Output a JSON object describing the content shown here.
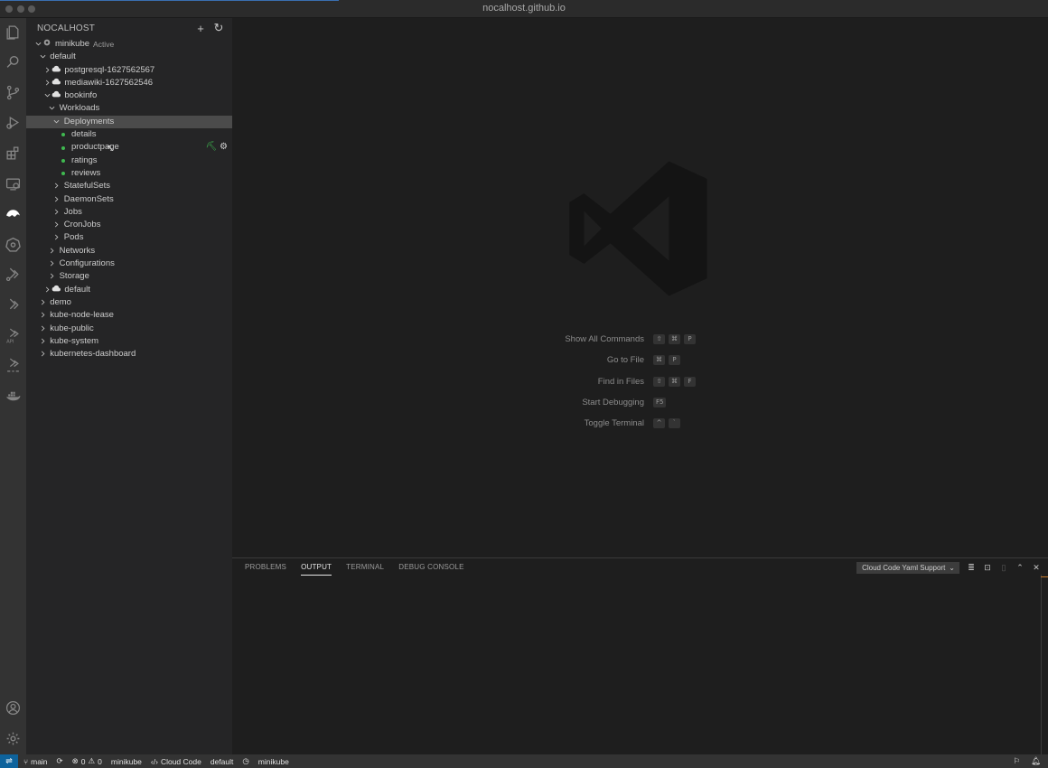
{
  "window": {
    "title": "nocalhost.github.io"
  },
  "sidebar": {
    "header": "NOCALHOST",
    "tree": [
      {
        "label": "minikube",
        "tag": "Active",
        "indent": 1,
        "chevron": "down",
        "icon": "cluster-icon"
      },
      {
        "label": "default",
        "indent": 2,
        "chevron": "down"
      },
      {
        "label": "postgresql-1627562567",
        "indent": 3,
        "chevron": "right",
        "icon": "cloud-icon"
      },
      {
        "label": "mediawiki-1627562546",
        "indent": 3,
        "chevron": "right",
        "icon": "cloud-icon"
      },
      {
        "label": "bookinfo",
        "indent": 3,
        "chevron": "down",
        "icon": "cloud-icon"
      },
      {
        "label": "Workloads",
        "indent": 4,
        "chevron": "down"
      },
      {
        "label": "Deployments",
        "indent": 5,
        "chevron": "down",
        "selected": true
      },
      {
        "label": "details",
        "indent": 6,
        "dot": true
      },
      {
        "label": "productpage",
        "indent": 6,
        "dot": true,
        "actions": true
      },
      {
        "label": "ratings",
        "indent": 6,
        "dot": true
      },
      {
        "label": "reviews",
        "indent": 6,
        "dot": true
      },
      {
        "label": "StatefulSets",
        "indent": 5,
        "chevron": "right"
      },
      {
        "label": "DaemonSets",
        "indent": 5,
        "chevron": "right"
      },
      {
        "label": "Jobs",
        "indent": 5,
        "chevron": "right"
      },
      {
        "label": "CronJobs",
        "indent": 5,
        "chevron": "right"
      },
      {
        "label": "Pods",
        "indent": 5,
        "chevron": "right"
      },
      {
        "label": "Networks",
        "indent": 4,
        "chevron": "right"
      },
      {
        "label": "Configurations",
        "indent": 4,
        "chevron": "right"
      },
      {
        "label": "Storage",
        "indent": 4,
        "chevron": "right"
      },
      {
        "label": "default",
        "indent": 3,
        "chevron": "right",
        "icon": "cloud-icon"
      },
      {
        "label": "demo",
        "indent": 2,
        "chevron": "right"
      },
      {
        "label": "kube-node-lease",
        "indent": 2,
        "chevron": "right"
      },
      {
        "label": "kube-public",
        "indent": 2,
        "chevron": "right"
      },
      {
        "label": "kube-system",
        "indent": 2,
        "chevron": "right"
      },
      {
        "label": "kubernetes-dashboard",
        "indent": 2,
        "chevron": "right"
      }
    ]
  },
  "editor": {
    "hints": [
      {
        "label": "Show All Commands",
        "keys": [
          "⇧",
          "⌘",
          "P"
        ]
      },
      {
        "label": "Go to File",
        "keys": [
          "⌘",
          "P"
        ]
      },
      {
        "label": "Find in Files",
        "keys": [
          "⇧",
          "⌘",
          "F"
        ]
      },
      {
        "label": "Start Debugging",
        "keys": [
          "F5"
        ]
      },
      {
        "label": "Toggle Terminal",
        "keys": [
          "^",
          "`"
        ]
      }
    ]
  },
  "panel": {
    "tabs": [
      "PROBLEMS",
      "OUTPUT",
      "TERMINAL",
      "DEBUG CONSOLE"
    ],
    "active_tab": "OUTPUT",
    "output_channel": "Cloud Code Yaml Support"
  },
  "statusbar": {
    "branch": "main",
    "errors": "0",
    "warnings": "0",
    "cluster": "minikube",
    "cloud_code": "Cloud Code",
    "namespace": "default",
    "context": "minikube"
  },
  "colors": {
    "accent": "#0e639c",
    "selected_row": "#4b4b4b",
    "running_dot": "#3fb950"
  }
}
